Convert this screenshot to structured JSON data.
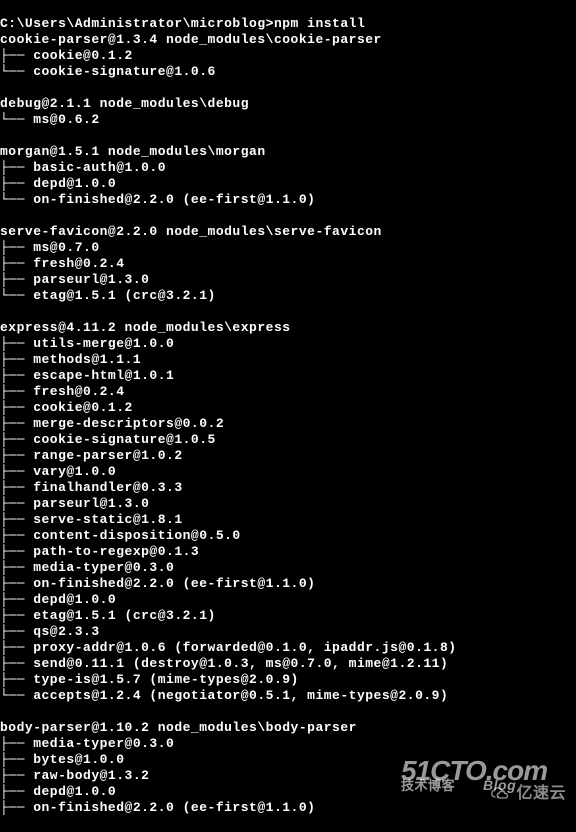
{
  "prompt": "C:\\Users\\Administrator\\microblog>npm install",
  "blocks": [
    {
      "header": "cookie-parser@1.3.4 node_modules\\cookie-parser",
      "items": [
        "├── cookie@0.1.2",
        "└── cookie-signature@1.0.6"
      ]
    },
    {
      "header": "debug@2.1.1 node_modules\\debug",
      "items": [
        "└── ms@0.6.2"
      ]
    },
    {
      "header": "morgan@1.5.1 node_modules\\morgan",
      "items": [
        "├── basic-auth@1.0.0",
        "├── depd@1.0.0",
        "└── on-finished@2.2.0 (ee-first@1.1.0)"
      ]
    },
    {
      "header": "serve-favicon@2.2.0 node_modules\\serve-favicon",
      "items": [
        "├── ms@0.7.0",
        "├── fresh@0.2.4",
        "├── parseurl@1.3.0",
        "└── etag@1.5.1 (crc@3.2.1)"
      ]
    },
    {
      "header": "express@4.11.2 node_modules\\express",
      "items": [
        "├── utils-merge@1.0.0",
        "├── methods@1.1.1",
        "├── escape-html@1.0.1",
        "├── fresh@0.2.4",
        "├── cookie@0.1.2",
        "├── merge-descriptors@0.0.2",
        "├── cookie-signature@1.0.5",
        "├── range-parser@1.0.2",
        "├── vary@1.0.0",
        "├── finalhandler@0.3.3",
        "├── parseurl@1.3.0",
        "├── serve-static@1.8.1",
        "├── content-disposition@0.5.0",
        "├── path-to-regexp@0.1.3",
        "├── media-typer@0.3.0",
        "├── on-finished@2.2.0 (ee-first@1.1.0)",
        "├── depd@1.0.0",
        "├── etag@1.5.1 (crc@3.2.1)",
        "├── qs@2.3.3",
        "├── proxy-addr@1.0.6 (forwarded@0.1.0, ipaddr.js@0.1.8)",
        "├── send@0.11.1 (destroy@1.0.3, ms@0.7.0, mime@1.2.11)",
        "├── type-is@1.5.7 (mime-types@2.0.9)",
        "└── accepts@1.2.4 (negotiator@0.5.1, mime-types@2.0.9)"
      ]
    },
    {
      "header": "body-parser@1.10.2 node_modules\\body-parser",
      "items": [
        "├── media-typer@0.3.0",
        "├── bytes@1.0.0",
        "├── raw-body@1.3.2",
        "├── depd@1.0.0",
        "├── on-finished@2.2.0 (ee-first@1.1.0)"
      ]
    }
  ],
  "watermark": {
    "main": "51CTO.com",
    "sub_left": "技术博客",
    "sub_right": "Blog",
    "suyun": "亿速云"
  }
}
